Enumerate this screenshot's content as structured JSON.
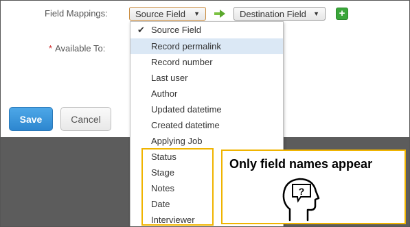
{
  "form": {
    "field_mappings_label": "Field Mappings:",
    "available_to_label": "Available To:",
    "required_marker": "*",
    "source_select": {
      "value": "Source Field",
      "icon": "caret-down-icon"
    },
    "destination_select": {
      "value": "Destination Field",
      "icon": "caret-down-icon"
    },
    "mapping_arrow_icon": "arrow-right-icon",
    "add_button_label": "+"
  },
  "buttons": {
    "save_label": "Save",
    "cancel_label": "Cancel"
  },
  "dropdown": {
    "selected_marker": "✔",
    "items": [
      {
        "label": "Source Field",
        "selected": true
      },
      {
        "label": "Record permalink",
        "hovered": true
      },
      {
        "label": "Record number"
      },
      {
        "label": "Last user"
      },
      {
        "label": "Author"
      },
      {
        "label": "Updated datetime"
      },
      {
        "label": "Created datetime"
      },
      {
        "label": "Applying Job"
      },
      {
        "label": "Status"
      },
      {
        "label": "Stage"
      },
      {
        "label": "Notes"
      },
      {
        "label": "Date"
      },
      {
        "label": "Interviewer"
      }
    ]
  },
  "annotation": {
    "callout_text": "Only field names appear",
    "callout_icon": "confused-head-icon",
    "question_mark": "?",
    "highlight_color": "#f0b400"
  },
  "colors": {
    "save_button": "#2d86cf",
    "add_button": "#3aa63a",
    "hover_row": "#dbe8f5",
    "backdrop": "#5c5c5c"
  }
}
